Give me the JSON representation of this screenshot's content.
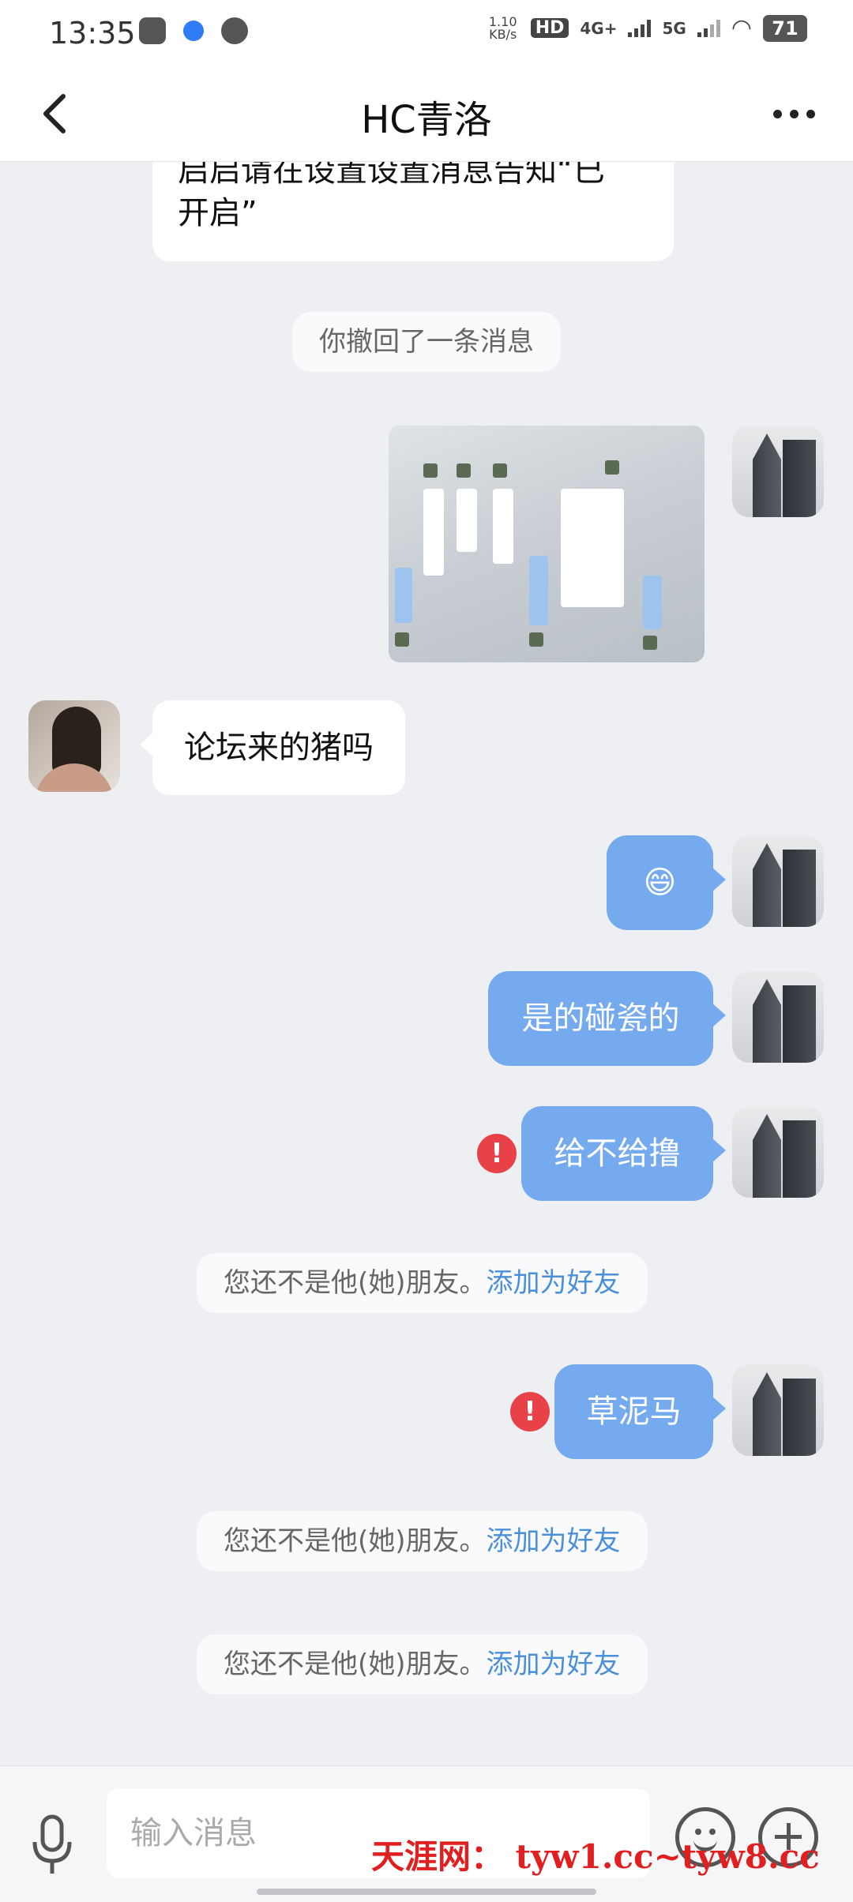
{
  "status_bar": {
    "time": "13:35",
    "net_speed": "1.10\nKB/s",
    "hd": "HD",
    "net1": "4G+",
    "net2": "5G",
    "battery": "71"
  },
  "header": {
    "title": "HC青洛"
  },
  "messages": {
    "top_partial_line1": "启启请在设置设置消息告知“已",
    "top_partial_line2": "开启”",
    "recall_notice": "你撤回了一条消息",
    "other_msg_1": "论坛来的猪吗",
    "me_emoji": "😄",
    "me_msg_1": "是的碰瓷的",
    "me_msg_2": "给不给撸",
    "me_msg_3": "草泥马",
    "error_icon": "!",
    "not_friend_text": "您还不是他(她)朋友。",
    "add_friend_link": "添加为好友"
  },
  "input": {
    "placeholder": "输入消息"
  },
  "watermark": "天涯网： tyw1.cc~tyw8.cc",
  "colors": {
    "bubble_blue": "#76aaef",
    "link": "#4a90d9",
    "error_red": "#e84148",
    "background": "#eeeff3"
  }
}
